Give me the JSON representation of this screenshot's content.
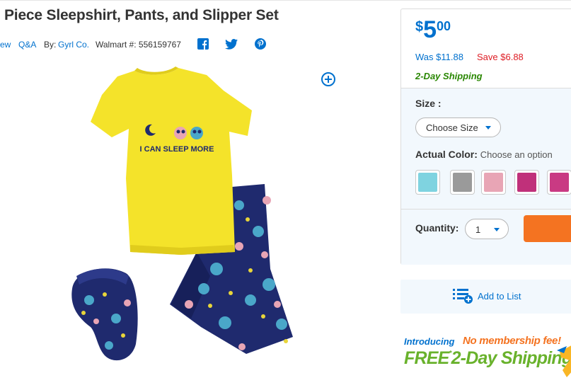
{
  "product": {
    "title": "Piece Sleepshirt, Pants, and Slipper Set",
    "meta": {
      "review_link": "ew",
      "qa_link": "Q&A",
      "by_prefix": "By:",
      "brand": "Gyrl Co.",
      "walmart_number": "Walmart #: 556159767"
    },
    "shirt_print": "I CAN SLEEP MORE",
    "social": [
      "facebook-icon",
      "twitter-icon",
      "pinterest-icon"
    ]
  },
  "pricing": {
    "currency": "$",
    "dollars": "5",
    "cents": "00",
    "was": "Was $11.88",
    "save": "Save $6.88",
    "shipping": "2-Day Shipping"
  },
  "options": {
    "size_label": "Size",
    "size_colon": ":",
    "size_select": "Choose Size",
    "color_label": "Actual Color",
    "color_colon": ":",
    "color_choose": "Choose an option",
    "swatches": [
      {
        "color": "#7fd3e0"
      },
      {
        "color": "#9a9a9a"
      },
      {
        "color": "#e8a5b5"
      },
      {
        "color": "#c0307a"
      },
      {
        "color": "#c93a83"
      }
    ],
    "quantity_label": "Quantity:",
    "quantity_value": "1"
  },
  "list": {
    "label": "Add to List"
  },
  "promo": {
    "introducing": "Introducing",
    "no_fee": "No membership fee!",
    "free": "FREE",
    "star": "*",
    "two_day": "2-Day Shipping"
  },
  "colors": {
    "link_blue": "#0071ce",
    "save_red": "#de1c24",
    "shipping_green": "#2a8703",
    "cart_orange": "#f47321",
    "panel_bg": "#f2f8fd"
  }
}
